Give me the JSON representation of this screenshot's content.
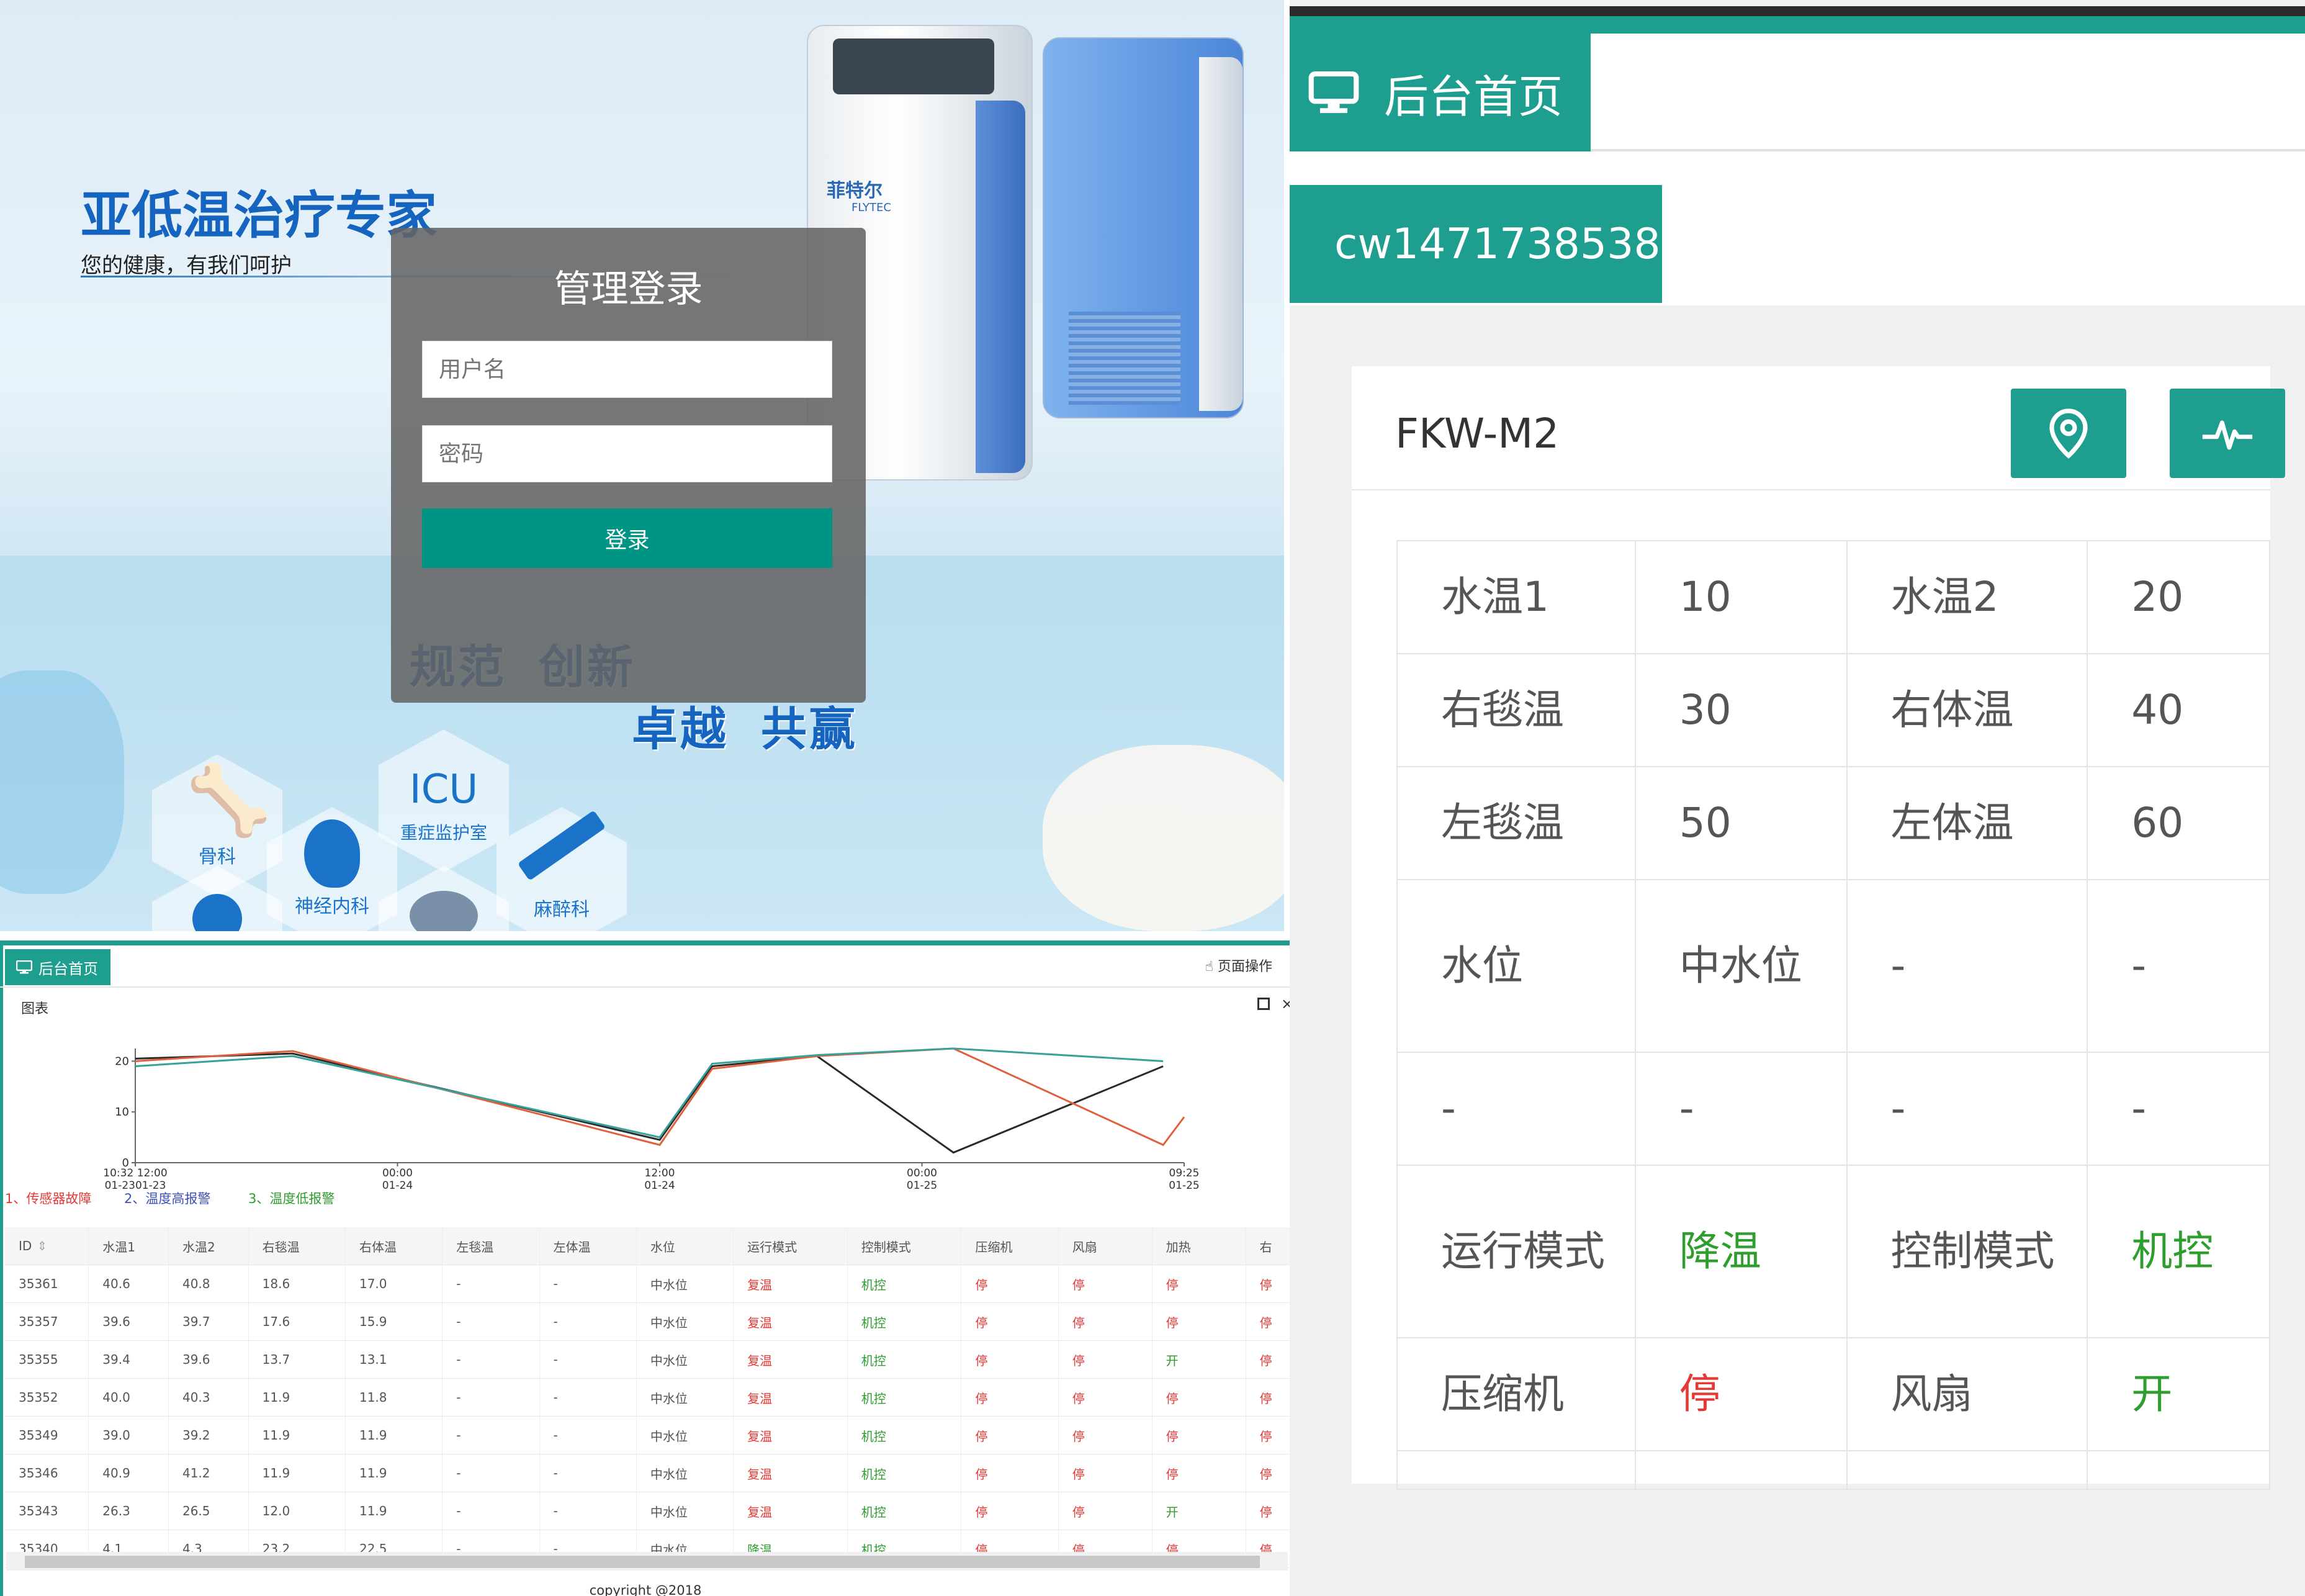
{
  "login": {
    "slogan": "亚低温治疗专家",
    "tagline": "您的健康，有我们呵护",
    "brand_cn": "菲特尔",
    "brand_en": "FLYTEC",
    "title": "管理登录",
    "username_placeholder": "用户名",
    "password_placeholder": "密码",
    "login_button": "登录",
    "motto_1a": "规范",
    "motto_1b": "创新",
    "motto_2a": "卓越",
    "motto_2b": "共赢",
    "hexagons": [
      {
        "label": "骨科"
      },
      {
        "label": "ICU",
        "sublabel": "重症监护室"
      },
      {
        "label": "神经内科"
      },
      {
        "label": "麻醉科"
      }
    ]
  },
  "dashboard": {
    "tab_label": "后台首页",
    "page_ops": "页面操作",
    "section_title": "图表",
    "legend": [
      {
        "text": "1、传感器故障",
        "color": "#e53935"
      },
      {
        "text": "2、温度高报警",
        "color": "#3f51b5"
      },
      {
        "text": "3、温度低报警",
        "color": "#2e9e2e"
      }
    ],
    "table": {
      "columns": [
        "ID",
        "水温1",
        "水温2",
        "右毯温",
        "右体温",
        "左毯温",
        "左体温",
        "水位",
        "运行模式",
        "控制模式",
        "压缩机",
        "风扇",
        "加热",
        "右"
      ],
      "rows": [
        [
          "35361",
          "40.6",
          "40.8",
          "18.6",
          "17.0",
          "-",
          "-",
          "中水位",
          "复温",
          "机控",
          "停",
          "停",
          "停",
          "停"
        ],
        [
          "35357",
          "39.6",
          "39.7",
          "17.6",
          "15.9",
          "-",
          "-",
          "中水位",
          "复温",
          "机控",
          "停",
          "停",
          "停",
          "停"
        ],
        [
          "35355",
          "39.4",
          "39.6",
          "13.7",
          "13.1",
          "-",
          "-",
          "中水位",
          "复温",
          "机控",
          "停",
          "停",
          "开",
          "停"
        ],
        [
          "35352",
          "40.0",
          "40.3",
          "11.9",
          "11.8",
          "-",
          "-",
          "中水位",
          "复温",
          "机控",
          "停",
          "停",
          "停",
          "停"
        ],
        [
          "35349",
          "39.0",
          "39.2",
          "11.9",
          "11.9",
          "-",
          "-",
          "中水位",
          "复温",
          "机控",
          "停",
          "停",
          "停",
          "停"
        ],
        [
          "35346",
          "40.9",
          "41.2",
          "11.9",
          "11.9",
          "-",
          "-",
          "中水位",
          "复温",
          "机控",
          "停",
          "停",
          "停",
          "停"
        ],
        [
          "35343",
          "26.3",
          "26.5",
          "12.0",
          "11.9",
          "-",
          "-",
          "中水位",
          "复温",
          "机控",
          "停",
          "停",
          "开",
          "停"
        ],
        [
          "35340",
          "4.1",
          "4.3",
          "23.2",
          "22.5",
          "-",
          "-",
          "中水位",
          "降温",
          "机控",
          "停",
          "停",
          "停",
          "停"
        ]
      ]
    },
    "copyright": "copyright @2018"
  },
  "chart_data": {
    "type": "line",
    "x_tick_labels": [
      [
        "10:32 12:00",
        "01-2301-23"
      ],
      [
        "00:00",
        "01-24"
      ],
      [
        "12:00",
        "01-24"
      ],
      [
        "00:00",
        "01-25"
      ],
      [
        "09:25",
        "01-25"
      ]
    ],
    "y_ticks": [
      0,
      10,
      20
    ],
    "ylim": [
      0,
      20
    ],
    "series": [
      {
        "color": "#2b2b2b",
        "values": [
          [
            0,
            20.5
          ],
          [
            0.15,
            21.5
          ],
          [
            0.5,
            4.5
          ],
          [
            0.55,
            19
          ],
          [
            0.65,
            21
          ],
          [
            0.78,
            2
          ],
          [
            0.98,
            19
          ]
        ]
      },
      {
        "color": "#e0603c",
        "values": [
          [
            0,
            20
          ],
          [
            0.15,
            22
          ],
          [
            0.5,
            3.5
          ],
          [
            0.55,
            18.5
          ],
          [
            0.65,
            21
          ],
          [
            0.78,
            24
          ],
          [
            0.98,
            3.5
          ],
          [
            1,
            9
          ]
        ]
      },
      {
        "color": "#3aa09a",
        "values": [
          [
            0,
            19
          ],
          [
            0.15,
            21
          ],
          [
            0.5,
            5
          ],
          [
            0.55,
            19.5
          ],
          [
            0.65,
            21.2
          ],
          [
            0.78,
            22.5
          ],
          [
            0.98,
            20
          ]
        ]
      }
    ]
  },
  "mobile": {
    "tab_label": "后台首页",
    "username": "cw1471738538",
    "device_name": "FKW-M2",
    "rows": [
      [
        {
          "t": "水温1"
        },
        {
          "t": "10"
        },
        {
          "t": "水温2"
        },
        {
          "t": "20"
        }
      ],
      [
        {
          "t": "右毯温"
        },
        {
          "t": "30"
        },
        {
          "t": "右体温"
        },
        {
          "t": "40"
        }
      ],
      [
        {
          "t": "左毯温"
        },
        {
          "t": "50"
        },
        {
          "t": "左体温"
        },
        {
          "t": "60"
        }
      ],
      [
        {
          "t": "水位"
        },
        {
          "t": "中水位"
        },
        {
          "t": "-"
        },
        {
          "t": "-"
        }
      ],
      [
        {
          "t": "-"
        },
        {
          "t": "-"
        },
        {
          "t": "-"
        },
        {
          "t": "-"
        }
      ],
      [
        {
          "t": "运行模式"
        },
        {
          "t": "降温",
          "c": "green"
        },
        {
          "t": "控制模式"
        },
        {
          "t": "机控",
          "c": "green"
        }
      ],
      [
        {
          "t": "压缩机"
        },
        {
          "t": "停",
          "c": "red"
        },
        {
          "t": "风扇"
        },
        {
          "t": "开",
          "c": "green"
        }
      ]
    ]
  }
}
